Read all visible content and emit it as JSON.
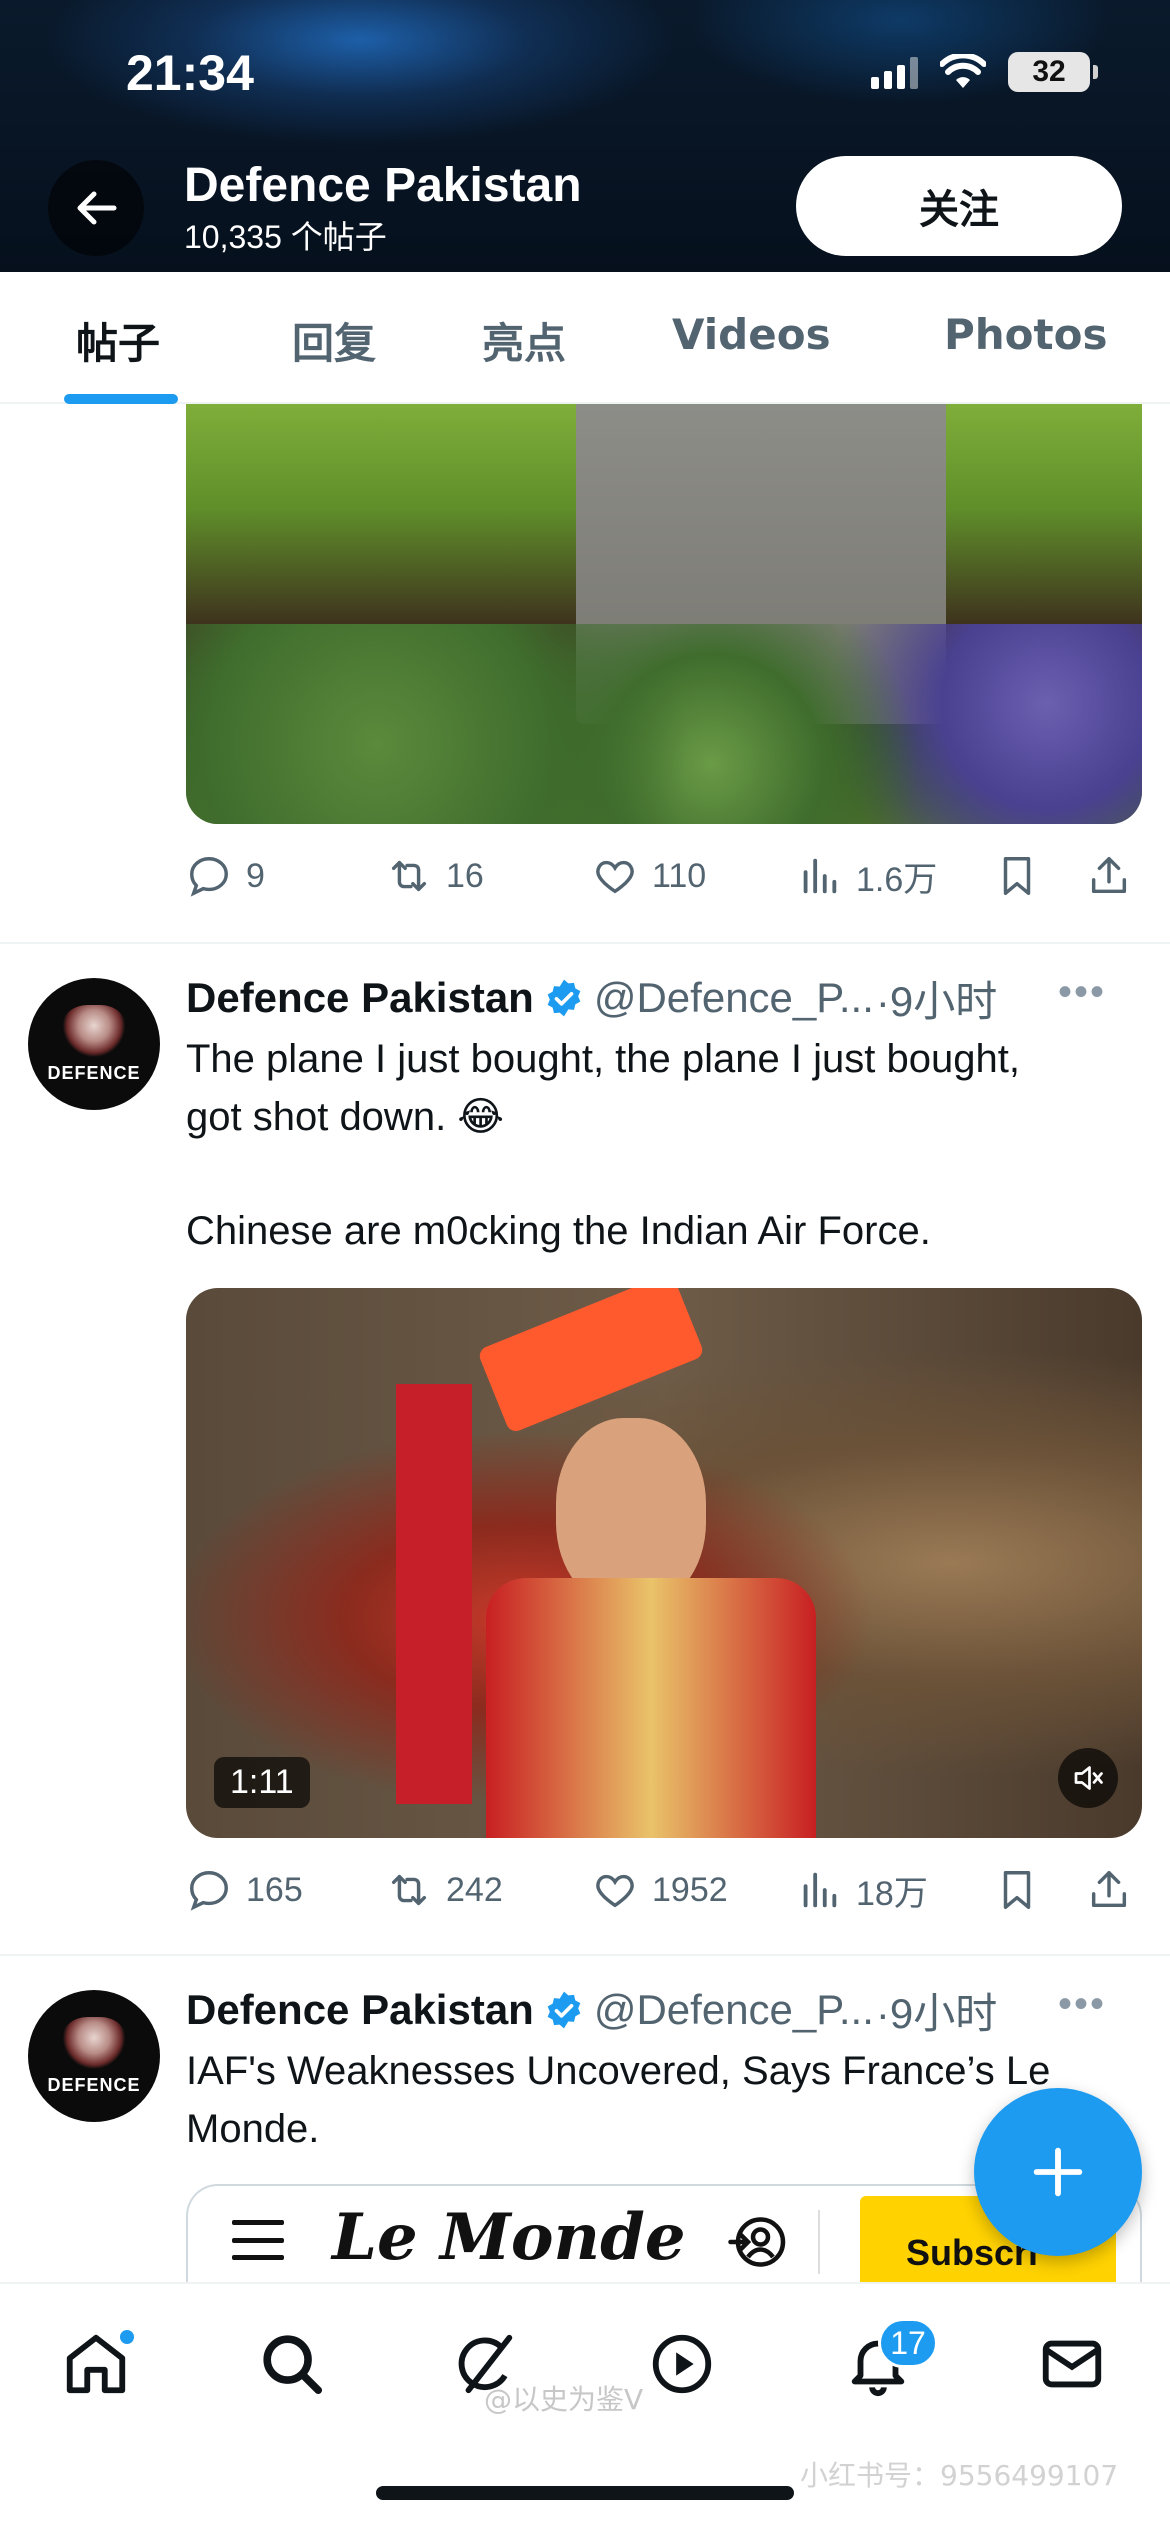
{
  "status_bar": {
    "time": "21:34",
    "battery": "32"
  },
  "header": {
    "name": "Defence Pakistan",
    "post_count": "10,335 个帖子",
    "follow_label": "关注"
  },
  "tabs": [
    {
      "label": "帖子",
      "active": true
    },
    {
      "label": "回复",
      "active": false
    },
    {
      "label": "亮点",
      "active": false
    },
    {
      "label": "Videos",
      "active": false
    },
    {
      "label": "Photos",
      "active": false
    }
  ],
  "posts": [
    {
      "media": "photo",
      "stats": {
        "replies": "9",
        "reposts": "16",
        "likes": "110",
        "views": "1.6万"
      }
    },
    {
      "author": "Defence Pakistan",
      "handle": "@Defence_P...",
      "time": "·9小时",
      "text_line1": "The plane I just bought, the plane I just bought,",
      "text_line2": "got shot down. 😂",
      "text_line3": "Chinese are m0cking the Indian Air Force.",
      "video_duration": "1:11",
      "stats": {
        "replies": "165",
        "reposts": "242",
        "likes": "1952",
        "views": "18万"
      }
    },
    {
      "author": "Defence Pakistan",
      "handle": "@Defence_P...",
      "time": "·9小时",
      "text_line1": "IAF's Weaknesses Uncovered, Says France’s Le",
      "text_line2": "Monde.",
      "card": {
        "logo": "Le Monde",
        "subscribe": "Subscri"
      }
    }
  ],
  "avatar_text": "DEFENCE",
  "bottom_nav": {
    "notifications_badge": "17"
  },
  "watermarks": {
    "weibo": "@以史为鉴V",
    "xhs": "小红书号：9556499107"
  },
  "colors": {
    "accent": "#1d9bf0",
    "text": "#0f1419",
    "muted": "#536471"
  },
  "icons": [
    "back-arrow-icon",
    "reply-icon",
    "repost-icon",
    "like-icon",
    "views-icon",
    "bookmark-icon",
    "share-icon",
    "verified-icon",
    "more-icon",
    "mute-icon",
    "compose-plus-icon",
    "home-icon",
    "search-icon",
    "grok-icon",
    "video-icon",
    "bell-icon",
    "mail-icon"
  ]
}
